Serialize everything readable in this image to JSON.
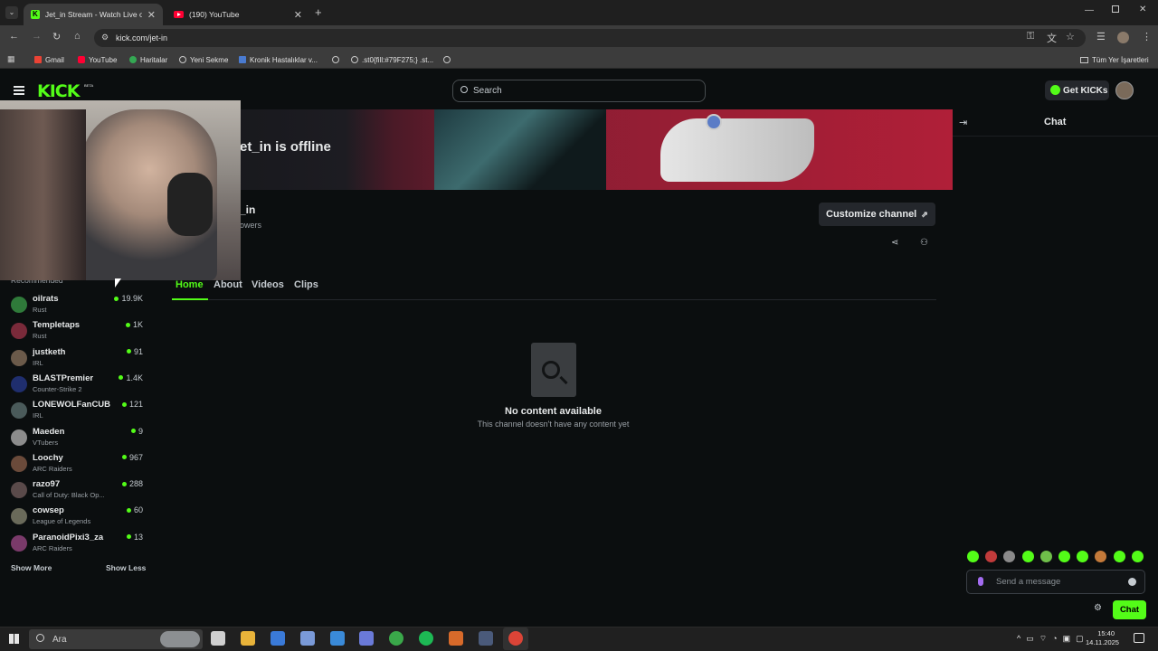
{
  "browser": {
    "tabs": [
      {
        "title": "Jet_in Stream - Watch Live on Ki"
      },
      {
        "title": "(190) YouTube"
      }
    ],
    "url": "kick.com/jet-in",
    "bookmarks": [
      {
        "label": "Gmail"
      },
      {
        "label": "YouTube"
      },
      {
        "label": "Haritalar"
      },
      {
        "label": "Yeni Sekme"
      },
      {
        "label": "Kronik Hastalıklar v..."
      },
      {
        "label": ".st0{fill:#79F275;} .st..."
      }
    ],
    "all_bookmarks": "Tüm Yer İşaretleri"
  },
  "kick": {
    "logo": "KICK",
    "logo_beta": "BETA",
    "search_placeholder": "Search",
    "get_kicks": "Get KICKs",
    "offline_text": "et_in is offline",
    "channel_name": "_in",
    "followers_text": "owers",
    "customize_label": "Customize channel",
    "nav_tabs": [
      {
        "label": "Home"
      },
      {
        "label": "About"
      },
      {
        "label": "Videos"
      },
      {
        "label": "Clips"
      }
    ],
    "recommended_heading": "Recommended",
    "recommended": [
      {
        "name": "oilrats",
        "category": "Rust",
        "viewers": "19.9K",
        "color": "#2f7a3a"
      },
      {
        "name": "Templetaps",
        "category": "Rust",
        "viewers": "1K",
        "color": "#7a2a3a"
      },
      {
        "name": "justketh",
        "category": "IRL",
        "viewers": "91",
        "color": "#6b5a4a"
      },
      {
        "name": "BLASTPremier",
        "category": "Counter-Strike 2",
        "viewers": "1.4K",
        "color": "#1f2e6e"
      },
      {
        "name": "LONEWOLFanCUB",
        "category": "IRL",
        "viewers": "121",
        "color": "#4a5a5a"
      },
      {
        "name": "Maeden",
        "category": "VTubers",
        "viewers": "9",
        "color": "#8c8c8c"
      },
      {
        "name": "Loochy",
        "category": "ARC Raiders",
        "viewers": "967",
        "color": "#6a4a3a"
      },
      {
        "name": "razo97",
        "category": "Call of Duty: Black Op...",
        "viewers": "288",
        "color": "#5a4a4a"
      },
      {
        "name": "cowsep",
        "category": "League of Legends",
        "viewers": "60",
        "color": "#6a6a5a"
      },
      {
        "name": "ParanoidPixi3_za",
        "category": "ARC Raiders",
        "viewers": "13",
        "color": "#7a3a6a"
      }
    ],
    "show_more": "Show More",
    "show_less": "Show Less",
    "empty_title": "No content available",
    "empty_subtitle": "This channel doesn't have any content yet",
    "chat_title": "Chat",
    "message_placeholder": "Send a message",
    "chat_button": "Chat",
    "accent": "#53fc18"
  },
  "taskbar": {
    "search_placeholder": "Ara",
    "time": "15:40",
    "date": "14.11.2025"
  }
}
